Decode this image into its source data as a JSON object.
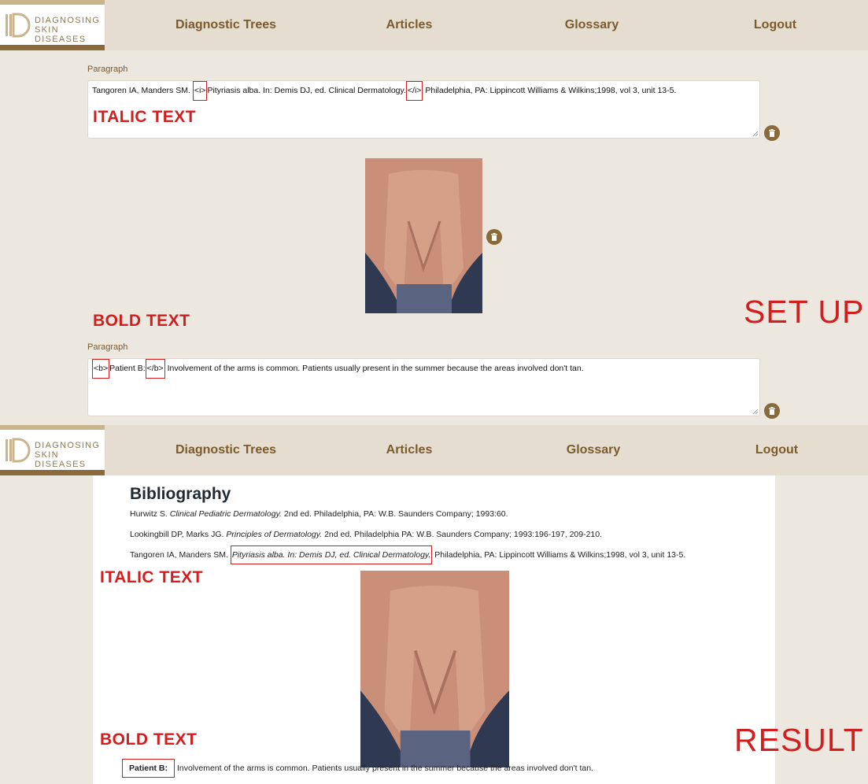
{
  "nav": {
    "logo_line1": "DIAGNOSING",
    "logo_line2": "SKIN DISEASES",
    "items": [
      "Diagnostic Trees",
      "Articles",
      "Glossary",
      "Logout"
    ]
  },
  "setup": {
    "italic_block": {
      "label": "Paragraph",
      "before": "Tangoren IA, Manders SM.",
      "open_tag": "<i>",
      "middle": "Pityriasis alba. In: Demis DJ, ed. Clinical Dermatology.",
      "close_tag": "</i>",
      "after": "Philadelphia, PA: Lippincott Williams & Wilkins;1998, vol 3, unit 13-5."
    },
    "italic_caption": "ITALIC TEXT",
    "bold_caption": "BOLD TEXT",
    "bold_block": {
      "label": "Paragraph",
      "open_tag": "<b>",
      "middle": "Patient B:",
      "close_tag": "</b>",
      "after": "Involvement of the arms is common. Patients usually present in the summer because the areas involved don't tan."
    },
    "big_label": "SET UP"
  },
  "result": {
    "title": "Bibliography",
    "refs": [
      {
        "authors": "Hurwitz S.",
        "title": "Clinical Pediatric Dermatology.",
        "rest": "2nd ed. Philadelphia, PA: W.B. Saunders Company; 1993:60."
      },
      {
        "authors": "Lookingbill DP, Marks JG.",
        "title": "Principles of Dermatology.",
        "rest": "2nd ed. Philadelphia PA: W.B. Saunders Company; 1993:196-197, 209-210."
      },
      {
        "authors": "Tangoren IA, Manders SM.",
        "title": "Pityriasis alba. In: Demis DJ, ed. Clinical Dermatology.",
        "rest": "Philadelphia, PA: Lippincott Williams & Wilkins;1998, vol 3, unit 13-5."
      }
    ],
    "italic_caption": "ITALIC TEXT",
    "bold_caption": "BOLD TEXT",
    "bold_line": {
      "bold": "Patient B:",
      "rest": "Involvement of the arms is common. Patients usually present in the summer because the areas involved don't tan."
    },
    "big_label": "RESULT"
  },
  "colors": {
    "accent_red": "#d21e1e",
    "brand_brown": "#7b5a2c",
    "nav_bg": "#e5ddcf",
    "page_bg": "#ede8df"
  },
  "icons": [
    "trash-icon",
    "logo-mark-icon"
  ]
}
